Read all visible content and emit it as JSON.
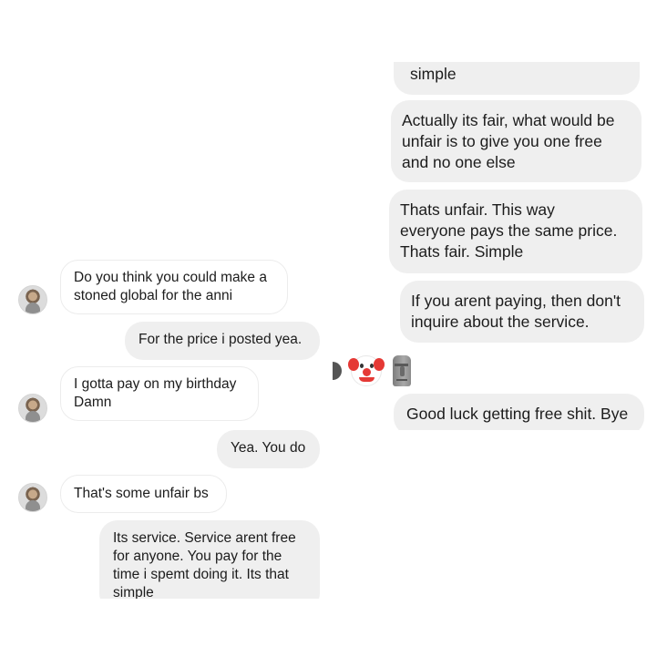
{
  "left_conversation": {
    "messages": [
      {
        "side": "incoming",
        "text": "Do you think you could make a\nstoned global for the anni"
      },
      {
        "side": "outgoing",
        "text": "For the price i posted yea."
      },
      {
        "side": "incoming",
        "text": "I gotta pay on my birthday\nDamn"
      },
      {
        "side": "outgoing",
        "text": "Yea. You do"
      },
      {
        "side": "incoming",
        "text": "That's some unfair bs"
      },
      {
        "side": "outgoing",
        "text": "Its service. Service arent free\nfor anyone. You pay for the\ntime i spemt doing it. Its that\nsimple"
      }
    ]
  },
  "right_conversation": {
    "messages": [
      {
        "side": "outgoing",
        "text": "simple"
      },
      {
        "side": "outgoing",
        "text": "Actually its fair, what would be\nunfair is to give you one free\nand no one else"
      },
      {
        "side": "outgoing",
        "text": "Thats unfair. This way\neveryone pays the same price.\nThats fair. Simple"
      },
      {
        "side": "outgoing",
        "text": "If you arent paying, then don't\ninquire about the service."
      },
      {
        "side": "outgoing",
        "text": "Good luck getting free shit. Bye"
      }
    ],
    "reactions": [
      "clown-face",
      "moai"
    ]
  }
}
